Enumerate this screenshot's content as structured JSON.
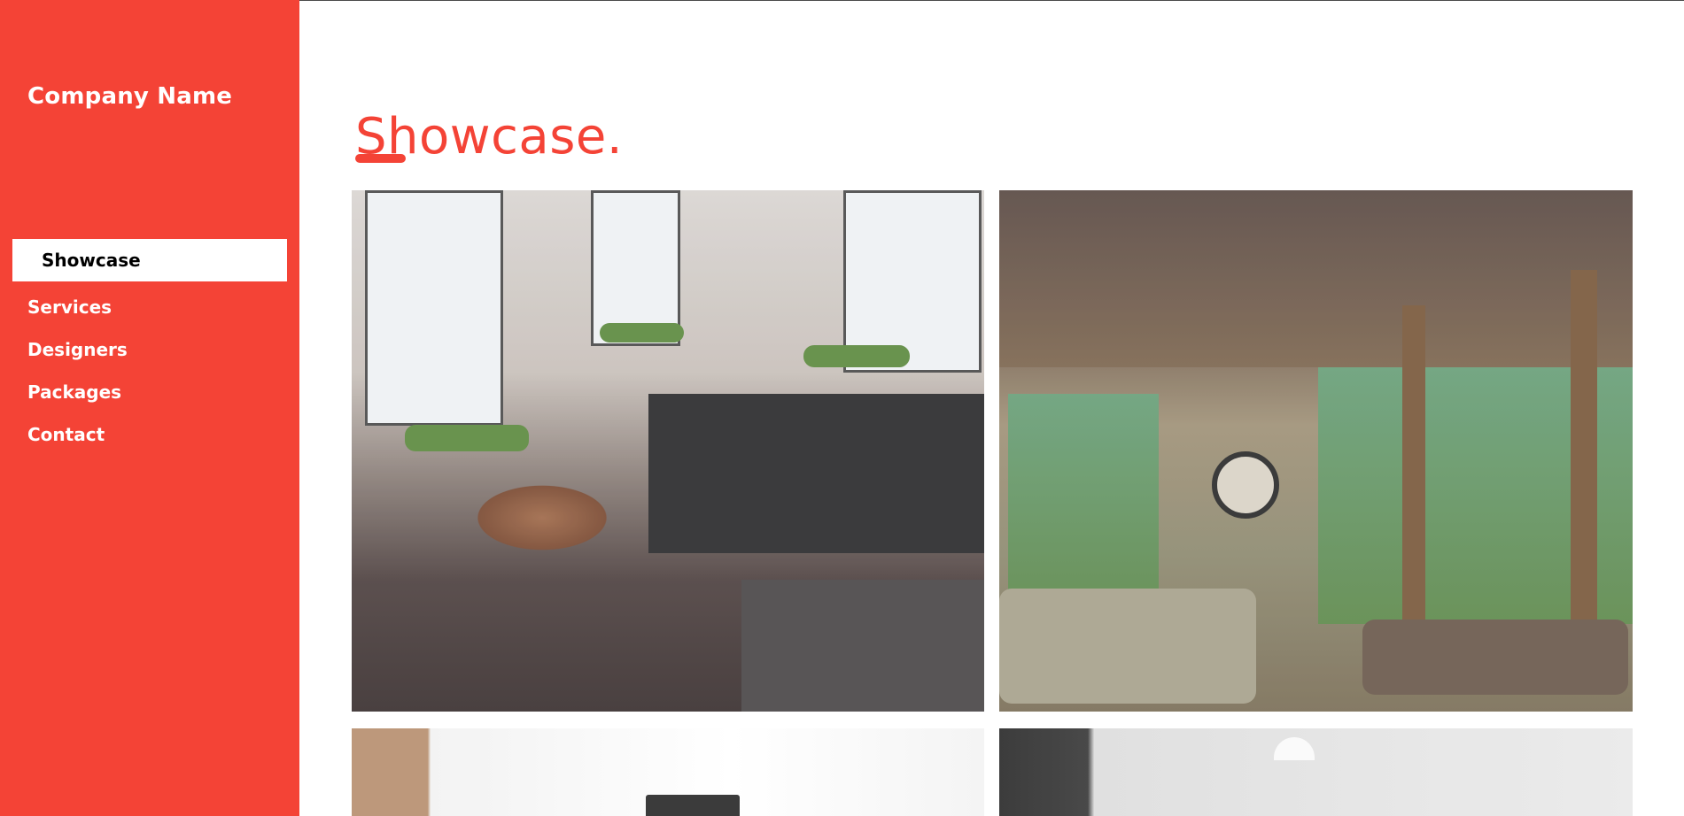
{
  "brand": {
    "name": "Company Name"
  },
  "nav": {
    "items": [
      {
        "label": "Showcase",
        "active": true
      },
      {
        "label": "Services",
        "active": false
      },
      {
        "label": "Designers",
        "active": false
      },
      {
        "label": "Packages",
        "active": false
      },
      {
        "label": "Contact",
        "active": false
      }
    ]
  },
  "main": {
    "title": "Showcase."
  },
  "colors": {
    "accent": "#f44336",
    "nav_active_bg": "#ffffff",
    "nav_active_text": "#000000"
  },
  "gallery": {
    "images": [
      {
        "name": "loft-kitchen-photo"
      },
      {
        "name": "living-room-porch-photo"
      },
      {
        "name": "bright-office-photo"
      },
      {
        "name": "white-room-photo"
      }
    ]
  }
}
